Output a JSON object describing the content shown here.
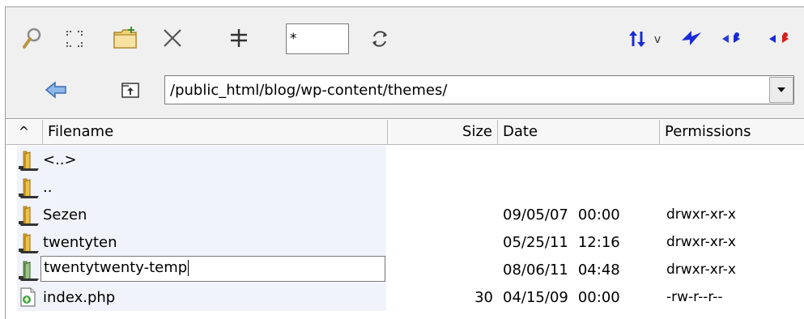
{
  "toolbar": {
    "filter_value": "*",
    "icons": [
      "search-icon",
      "select-all-icon",
      "new-folder-icon",
      "delete-icon",
      "add-icon",
      "refresh-icon",
      "sort-icon",
      "sort-dropdown-icon",
      "lightning-icon",
      "compare-blue-icon",
      "compare-red-icon"
    ],
    "sort_menu_glyph": "v"
  },
  "navigation": {
    "path": "/public_html/blog/wp-content/themes/",
    "icons": [
      "back-arrow-icon",
      "parent-folder-icon",
      "dropdown-arrow-icon"
    ]
  },
  "columns": {
    "sort_indicator": "^",
    "filename": "Filename",
    "size": "Size",
    "date": "Date",
    "permissions": "Permissions"
  },
  "files": [
    {
      "name": "<..>",
      "size": "",
      "date": "",
      "time": "",
      "permissions": "",
      "icon": "folder-icon"
    },
    {
      "name": "..",
      "size": "",
      "date": "",
      "time": "",
      "permissions": "",
      "icon": "folder-icon"
    },
    {
      "name": "Sezen",
      "size": "",
      "date": "09/05/07",
      "time": "00:00",
      "permissions": "drwxr-xr-x",
      "icon": "folder-icon"
    },
    {
      "name": "twentyten",
      "size": "",
      "date": "05/25/11",
      "time": "12:16",
      "permissions": "drwxr-xr-x",
      "icon": "folder-icon"
    },
    {
      "name": "twentytwenty-temp",
      "size": "",
      "date": "08/06/11",
      "time": "04:48",
      "permissions": "drwxr-xr-x",
      "icon": "folder-green-icon",
      "editing": true
    },
    {
      "name": "index.php",
      "size": "30",
      "date": "04/15/09",
      "time": "00:00",
      "permissions": "-rw-r--r--",
      "icon": "php-file-icon"
    }
  ],
  "colors": {
    "toolbar_bg": "#f0f0f0",
    "row_highlight": "#f1f3fb",
    "folder_yellow": "#e8b73a",
    "accent_blue": "#1a2ad6",
    "accent_red": "#d81e1e"
  }
}
